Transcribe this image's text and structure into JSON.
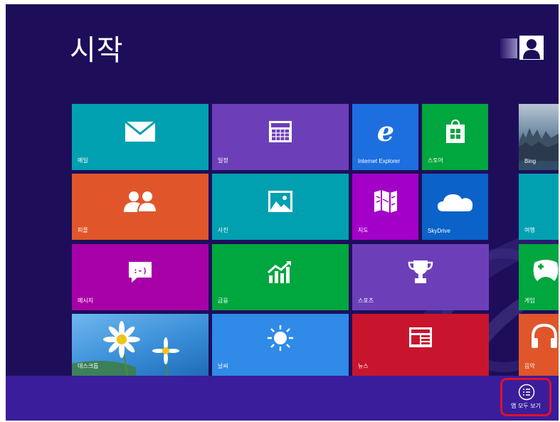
{
  "start": {
    "title": "시작",
    "tiles": [
      {
        "label": "메일",
        "color": "#00a0b1",
        "icon": "mail-icon"
      },
      {
        "label": "일정",
        "color": "#6c3fb9",
        "icon": "calendar-icon"
      },
      {
        "label": "Internet Explorer",
        "color": "#1d6fe0",
        "icon": "internet-explorer-icon"
      },
      {
        "label": "스토어",
        "color": "#00a63e",
        "icon": "store-icon"
      },
      {
        "label": "Bing",
        "color": "#3a5a7a",
        "icon": "bing-image"
      },
      {
        "label": "피플",
        "color": "#e0562a",
        "icon": "people-icon"
      },
      {
        "label": "사진",
        "color": "#00a0b1",
        "icon": "photos-icon"
      },
      {
        "label": "지도",
        "color": "#a300c8",
        "icon": "maps-icon"
      },
      {
        "label": "SkyDrive",
        "color": "#0b62c8",
        "icon": "skydrive-icon"
      },
      {
        "label": "여행",
        "color": "#00a0b1",
        "icon": "travel-icon"
      },
      {
        "label": "메시지",
        "color": "#a800a8",
        "icon": "messaging-icon"
      },
      {
        "label": "금융",
        "color": "#00a63e",
        "icon": "finance-icon"
      },
      {
        "label": "스포츠",
        "color": "#6c3fb9",
        "icon": "sports-trophy-icon"
      },
      {
        "label": "게임",
        "color": "#00a63e",
        "icon": "games-controller-icon"
      },
      {
        "label": "데스크톱",
        "color": "#3a8fd8",
        "icon": "desktop-daisy-image"
      },
      {
        "label": "날씨",
        "color": "#2f8ae8",
        "icon": "weather-sun-icon"
      },
      {
        "label": "뉴스",
        "color": "#c8152d",
        "icon": "news-icon"
      },
      {
        "label": "음악",
        "color": "#e0562a",
        "icon": "music-headphones-icon"
      }
    ]
  },
  "appbar": {
    "all_apps_label": "앱 모두 보기",
    "icon": "all-apps-list-icon"
  },
  "colors": {
    "background": "#1e0e5a",
    "appbar": "#3a1d9b",
    "highlight": "#e0102b"
  }
}
